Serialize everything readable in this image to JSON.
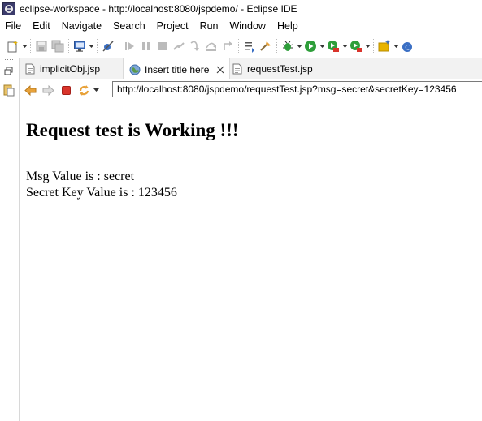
{
  "window": {
    "title": "eclipse-workspace - http://localhost:8080/jspdemo/ - Eclipse IDE"
  },
  "menu": [
    "File",
    "Edit",
    "Navigate",
    "Search",
    "Project",
    "Run",
    "Window",
    "Help"
  ],
  "tabs": [
    {
      "label": "implicitObj.jsp",
      "icon": "jsp-file-icon",
      "active": false
    },
    {
      "label": "Insert title here",
      "icon": "globe-icon",
      "active": true
    },
    {
      "label": "requestTest.jsp",
      "icon": "jsp-file-icon",
      "active": false
    }
  ],
  "browser": {
    "url": "http://localhost:8080/jspdemo/requestTest.jsp?msg=secret&secretKey=123456"
  },
  "page": {
    "heading": "Request test is Working !!!",
    "msg_line": "Msg Value is : secret",
    "key_line": "Secret Key Value is : 123456"
  },
  "colors": {
    "run_green": "#2e9e3a",
    "stop_red": "#d9342b",
    "nav_orange": "#e8a23a",
    "toolbar_blue": "#3a6fc4"
  }
}
